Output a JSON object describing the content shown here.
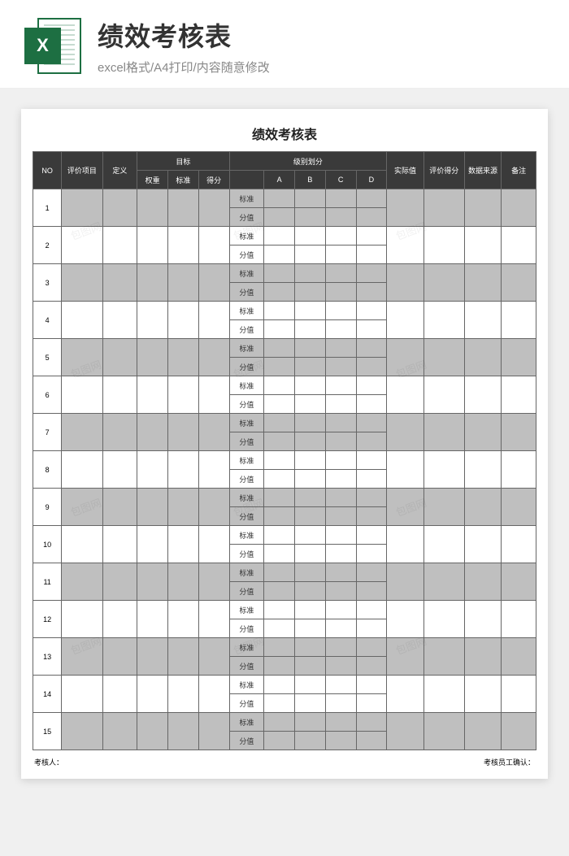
{
  "header": {
    "icon_letter": "X",
    "title": "绩效考核表",
    "subtitle": "excel格式/A4打印/内容随意修改"
  },
  "sheet": {
    "title": "绩效考核表",
    "columns": {
      "no": "NO",
      "eval_item": "评价项目",
      "definition": "定义",
      "target_group": "目标",
      "weight": "权重",
      "standard": "标准",
      "score": "得分",
      "grade_group": "级别划分",
      "grade_label": "",
      "grade_a": "A",
      "grade_b": "B",
      "grade_c": "C",
      "grade_d": "D",
      "actual": "实际值",
      "eval_score": "评价得分",
      "data_source": "数据来源",
      "remark": "备注"
    },
    "row_labels": {
      "standard": "标准",
      "score": "分值"
    },
    "row_count": 15,
    "footer": {
      "left": "考核人：",
      "right": "考核员工确认："
    }
  },
  "watermark": "包图网"
}
